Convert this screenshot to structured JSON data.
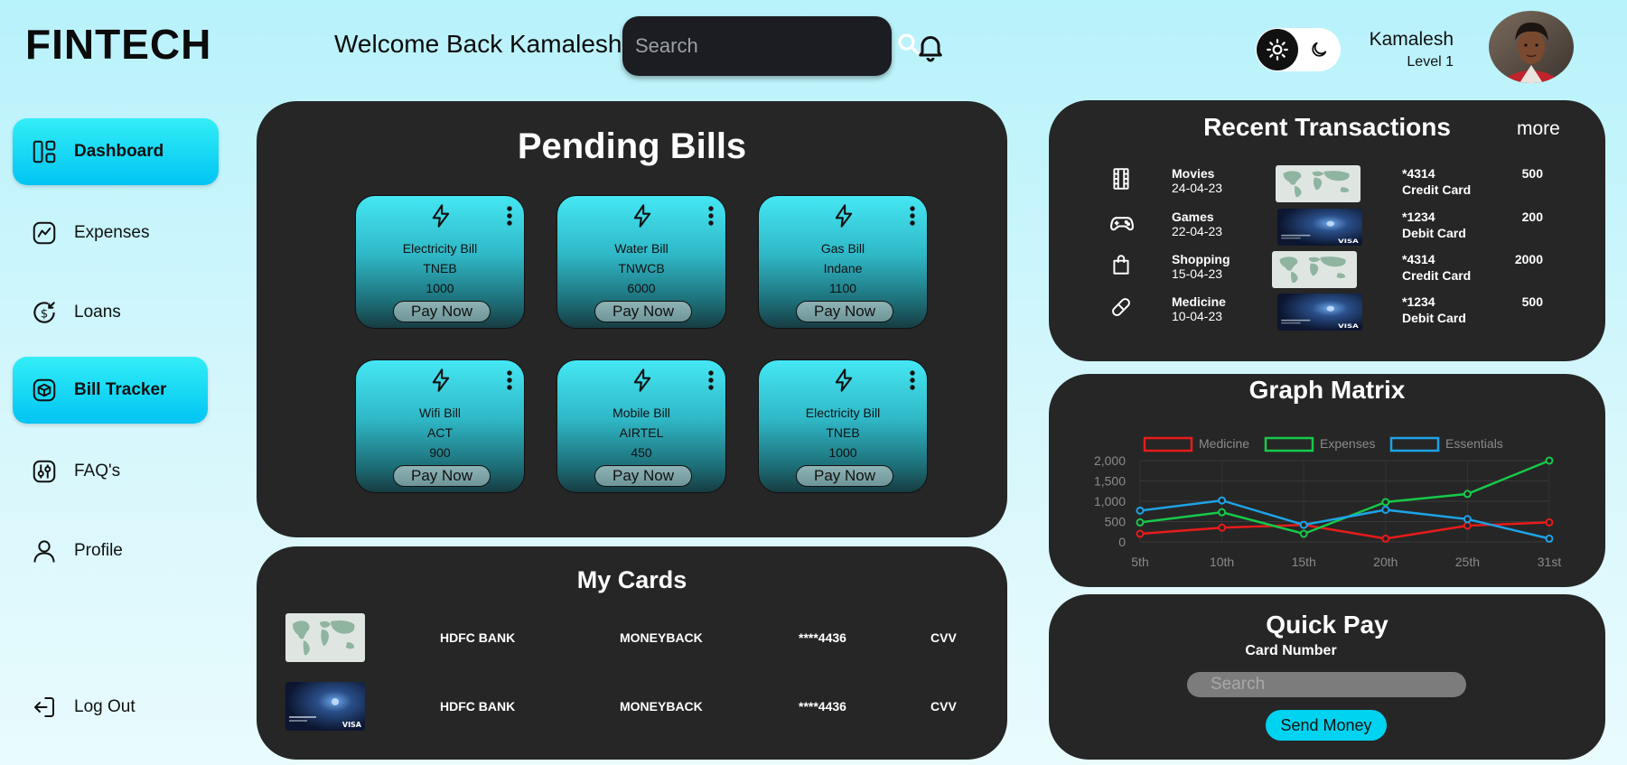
{
  "app": {
    "logo": "FINTECH"
  },
  "header": {
    "welcome": "Welcome Back Kamalesh",
    "search_placeholder": "Search",
    "user_name": "Kamalesh",
    "user_level": "Level 1"
  },
  "sidebar": {
    "items": [
      {
        "label": "Dashboard",
        "icon": "dashboard-icon",
        "active": true
      },
      {
        "label": "Expenses",
        "icon": "chart-icon",
        "active": false
      },
      {
        "label": "Loans",
        "icon": "loan-icon",
        "active": false
      },
      {
        "label": "Bill Tracker",
        "icon": "box-icon",
        "active": true
      },
      {
        "label": "FAQ's",
        "icon": "sliders-icon",
        "active": false
      },
      {
        "label": "Profile",
        "icon": "user-icon",
        "active": false
      }
    ],
    "logout": "Log Out"
  },
  "pending_bills": {
    "title": "Pending Bills",
    "bills": [
      {
        "name": "Electricity Bill",
        "provider": "TNEB",
        "amount": "1000",
        "action": "Pay Now"
      },
      {
        "name": "Water Bill",
        "provider": "TNWCB",
        "amount": "6000",
        "action": "Pay Now"
      },
      {
        "name": "Gas Bill",
        "provider": "Indane",
        "amount": "1100",
        "action": "Pay Now"
      },
      {
        "name": "Wifi Bill",
        "provider": "ACT",
        "amount": "900",
        "action": "Pay Now"
      },
      {
        "name": "Mobile Bill",
        "provider": "AIRTEL",
        "amount": "450",
        "action": "Pay Now"
      },
      {
        "name": "Electricity Bill",
        "provider": "TNEB",
        "amount": "1000",
        "action": "Pay Now"
      }
    ]
  },
  "my_cards": {
    "title": "My Cards",
    "cards": [
      {
        "bank": "HDFC BANK",
        "type": "MONEYBACK",
        "number": "****4436",
        "cvv": "CVV",
        "design": "world-map"
      },
      {
        "bank": "HDFC BANK",
        "type": "MONEYBACK",
        "number": "****4436",
        "cvv": "CVV",
        "design": "visa-dark"
      }
    ]
  },
  "recent_transactions": {
    "title": "Recent Transactions",
    "more": "more",
    "rows": [
      {
        "category": "Movies",
        "date": "24-04-23",
        "card": "*4314",
        "card_type": "Credit Card",
        "amount": "500",
        "icon": "film-icon",
        "design": "world-map"
      },
      {
        "category": "Games",
        "date": "22-04-23",
        "card": "*1234",
        "card_type": "Debit Card",
        "amount": "200",
        "icon": "gamepad-icon",
        "design": "visa-dark"
      },
      {
        "category": "Shopping",
        "date": "15-04-23",
        "card": "*4314",
        "card_type": "Credit Card",
        "amount": "2000",
        "icon": "shopping-bag-icon",
        "design": "world-map"
      },
      {
        "category": "Medicine",
        "date": "10-04-23",
        "card": "*1234",
        "card_type": "Debit Card",
        "amount": "500",
        "icon": "pill-icon",
        "design": "visa-dark"
      }
    ]
  },
  "graph_matrix": {
    "title": "Graph Matrix"
  },
  "chart_data": {
    "type": "line",
    "title": "Graph Matrix",
    "categories": [
      "5th",
      "10th",
      "15th",
      "20th",
      "25th",
      "31st"
    ],
    "ylim": [
      0,
      2000
    ],
    "yticks": [
      "0",
      "500",
      "1,000",
      "1,500",
      "2,000"
    ],
    "legend_position": "top",
    "series": [
      {
        "name": "Medicine",
        "color": "#e81b1b",
        "values": [
          200,
          350,
          420,
          80,
          400,
          480
        ]
      },
      {
        "name": "Expenses",
        "color": "#17c94a",
        "values": [
          480,
          730,
          200,
          980,
          1180,
          2000
        ]
      },
      {
        "name": "Essentials",
        "color": "#1ea3e6",
        "values": [
          770,
          1020,
          420,
          790,
          560,
          80
        ]
      }
    ]
  },
  "quick_pay": {
    "title": "Quick Pay",
    "card_label": "Card Number",
    "placeholder": "Search",
    "button": "Send Money"
  }
}
